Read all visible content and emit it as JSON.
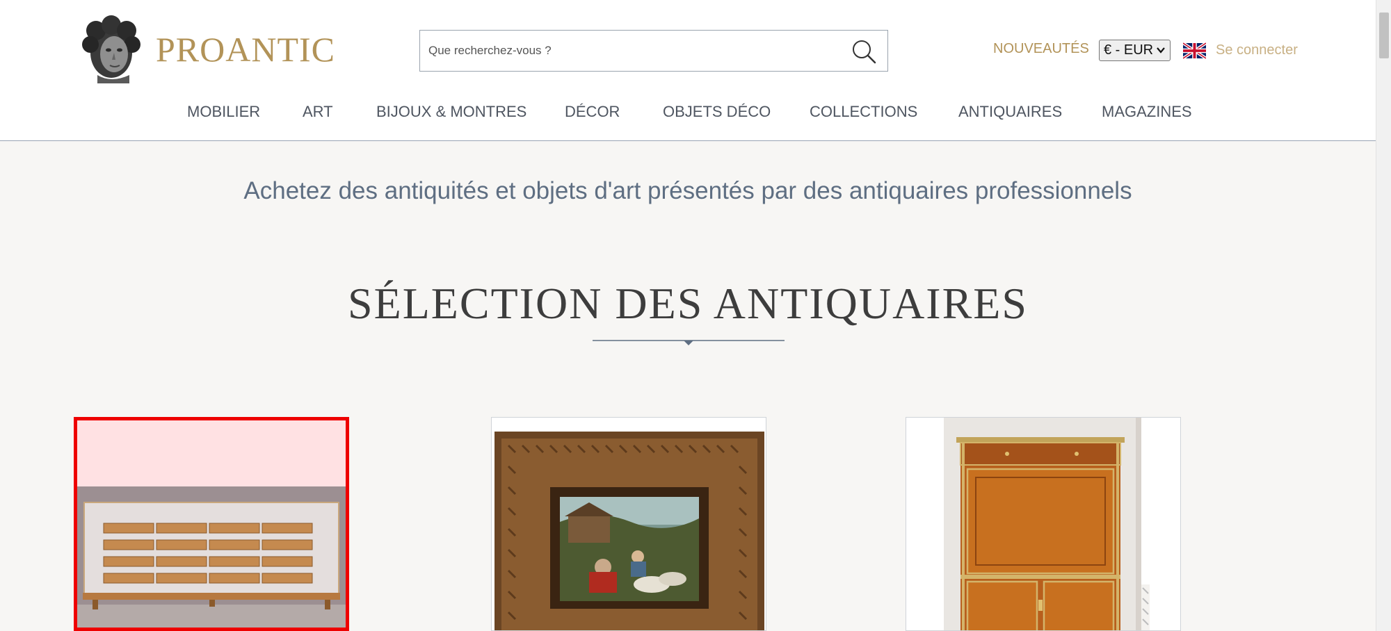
{
  "header": {
    "logo_text": "PROANTIC",
    "search_placeholder": "Que recherchez-vous ?",
    "new_label": "NOUVEAUTÉS",
    "currency_value": "€ - EUR",
    "language": "English (UK flag)",
    "login_label": "Se connecter"
  },
  "nav": {
    "items": [
      {
        "label": "MOBILIER"
      },
      {
        "label": "ART"
      },
      {
        "label": "BIJOUX & MONTRES"
      },
      {
        "label": "DÉCOR"
      },
      {
        "label": "OBJETS DÉCO"
      },
      {
        "label": "COLLECTIONS"
      },
      {
        "label": "ANTIQUAIRES"
      },
      {
        "label": "MAGAZINES"
      }
    ]
  },
  "main": {
    "tagline": "Achetez des antiquités et objets d'art présentés par des antiquaires professionnels",
    "section_title": "SÉLECTION DES ANTIQUAIRES",
    "cards": [
      {
        "subject": "Glass display cabinet with wooden shelves",
        "selected": true
      },
      {
        "subject": "Oil painting in carved wooden frame",
        "selected": false
      },
      {
        "subject": "Satinwood secretary cabinet",
        "selected": false
      }
    ]
  },
  "colors": {
    "gold": "#b29358",
    "nav_text": "#4e5560",
    "tagline": "#5e6e82",
    "highlight": "#ee0000"
  }
}
